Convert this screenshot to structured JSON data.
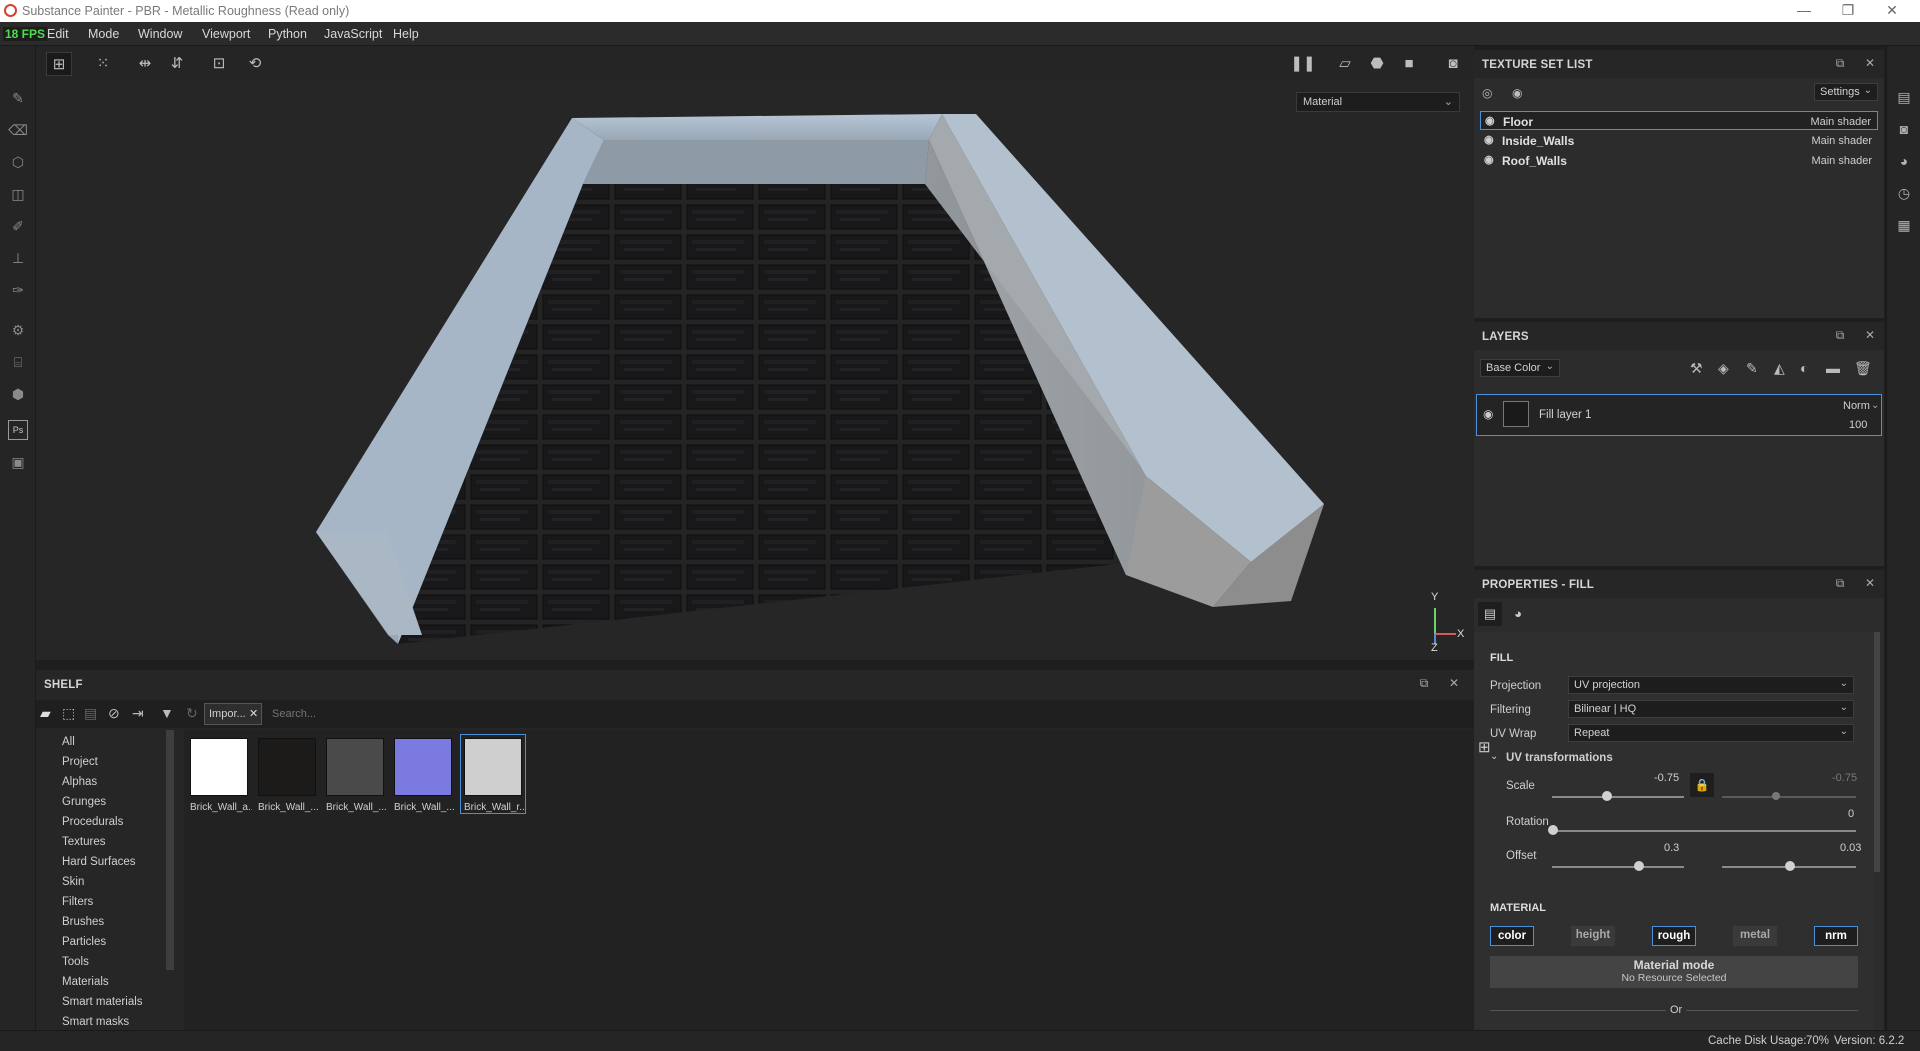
{
  "window": {
    "title": "Substance Painter - PBR - Metallic Roughness (Read only)",
    "minimize": "—",
    "restore": "❐",
    "close": "✕"
  },
  "menu": {
    "fps": "18 FPS",
    "items": [
      "Edit",
      "Mode",
      "Window",
      "Viewport",
      "Python",
      "JavaScript",
      "Help"
    ]
  },
  "viewport": {
    "material_select": "Material",
    "axis": {
      "y": "Y",
      "x": "X",
      "z": "Z"
    }
  },
  "texture_set_list": {
    "title": "TEXTURE SET LIST",
    "settings_label": "Settings",
    "sets": [
      {
        "name": "Floor",
        "shader": "Main shader"
      },
      {
        "name": "Inside_Walls",
        "shader": "Main shader"
      },
      {
        "name": "Roof_Walls",
        "shader": "Main shader"
      }
    ]
  },
  "layers": {
    "title": "LAYERS",
    "channel_select": "Base Color",
    "layer": {
      "name": "Fill layer 1",
      "blend": "Norm",
      "opacity": "100"
    }
  },
  "properties": {
    "title": "PROPERTIES - FILL",
    "fill_header": "FILL",
    "projection_label": "Projection",
    "projection_value": "UV projection",
    "filtering_label": "Filtering",
    "filtering_value": "Bilinear | HQ",
    "uvwrap_label": "UV Wrap",
    "uvwrap_value": "Repeat",
    "uvtransform_header": "UV transformations",
    "scale_label": "Scale",
    "scale_u": "-0.75",
    "scale_v": "-0.75",
    "rotation_label": "Rotation",
    "rotation_value": "0",
    "offset_label": "Offset",
    "offset_u": "0.3",
    "offset_v": "0.03",
    "material_header": "MATERIAL",
    "channels": [
      {
        "label": "color",
        "on": true
      },
      {
        "label": "height",
        "on": false
      },
      {
        "label": "rough",
        "on": true
      },
      {
        "label": "metal",
        "on": false
      },
      {
        "label": "nrm",
        "on": true
      }
    ],
    "material_mode_title": "Material mode",
    "material_mode_sub": "No Resource Selected",
    "or_label": "Or"
  },
  "shelf": {
    "title": "SHELF",
    "filter_tag": "Impor...",
    "search_placeholder": "Search...",
    "categories": [
      "All",
      "Project",
      "Alphas",
      "Grunges",
      "Procedurals",
      "Textures",
      "Hard Surfaces",
      "Skin",
      "Filters",
      "Brushes",
      "Particles",
      "Tools",
      "Materials",
      "Smart materials",
      "Smart masks"
    ],
    "resources": [
      {
        "name": "Brick_Wall_a...",
        "color": "#ffffff"
      },
      {
        "name": "Brick_Wall_...",
        "color": "#1c1b1a"
      },
      {
        "name": "Brick_Wall_...",
        "color": "#4a4a4a"
      },
      {
        "name": "Brick_Wall_...",
        "color": "#7b7ae0"
      },
      {
        "name": "Brick_Wall_r...",
        "color": "#cfcfcf"
      }
    ]
  },
  "status": {
    "cache": "Cache Disk Usage:",
    "cache_pct": "70%",
    "version": "Version: 6.2.2"
  }
}
